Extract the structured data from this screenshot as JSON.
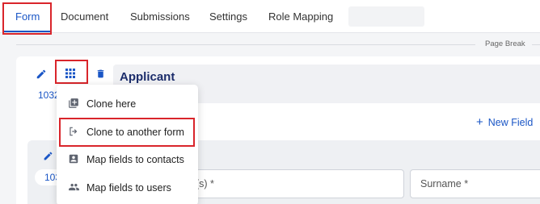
{
  "tabs": [
    {
      "label": "Form",
      "active": true
    },
    {
      "label": "Document"
    },
    {
      "label": "Submissions"
    },
    {
      "label": "Settings"
    },
    {
      "label": "Role Mapping"
    }
  ],
  "page_break_label": "Page Break",
  "section": {
    "title": "Applicant",
    "id": "1032",
    "new_field_label": "New Field"
  },
  "sub_section": {
    "id": "103"
  },
  "fields": {
    "first_names_placeholder": "e(s) *",
    "surname_placeholder": "Surname *"
  },
  "context_menu": {
    "items": [
      {
        "label": "Clone here",
        "icon": "clone-add-icon"
      },
      {
        "label": "Clone to another form",
        "icon": "export-icon"
      },
      {
        "label": "Map fields to contacts",
        "icon": "contact-card-icon"
      },
      {
        "label": "Map fields to users",
        "icon": "users-icon"
      }
    ]
  },
  "colors": {
    "accent": "#1a56c6",
    "highlight": "#d9252b",
    "title": "#1c2d6b"
  }
}
